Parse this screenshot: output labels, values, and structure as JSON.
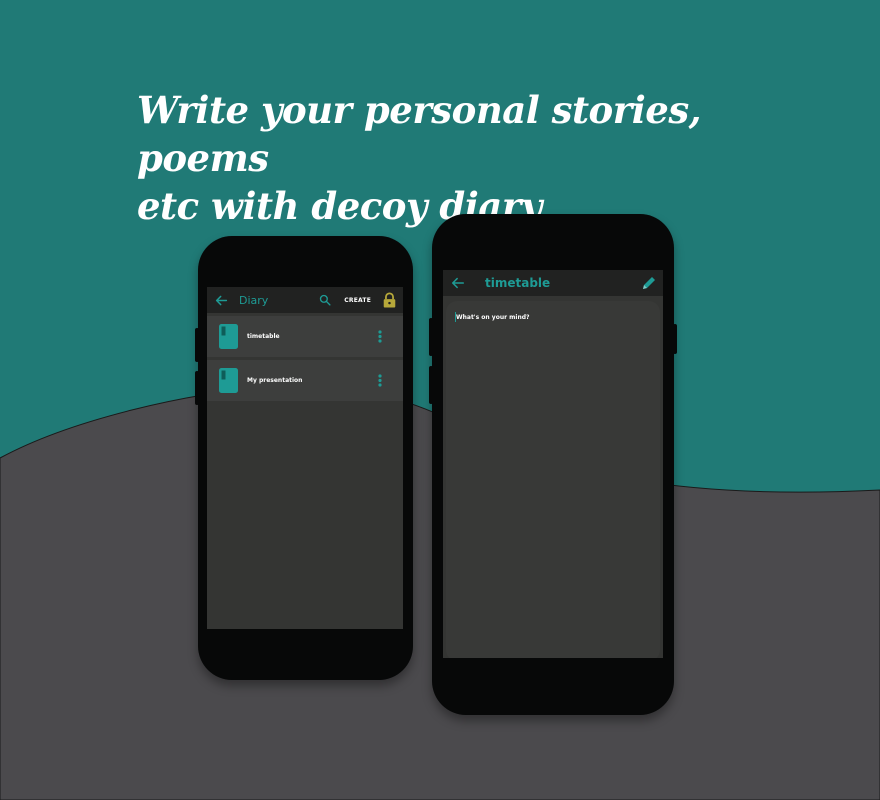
{
  "headline": {
    "line1": "Write your personal stories, poems",
    "line2": "etc with decoy diary"
  },
  "colors": {
    "teal_bg": "#207a76",
    "grey_wave": "#4b4a4d",
    "accent": "#1e9b95",
    "lock": "#b6a83a"
  },
  "phone_list": {
    "appbar": {
      "back_icon": "arrow-left-icon",
      "title": "Diary",
      "search_icon": "search-icon",
      "create_label": "CREATE",
      "lock_icon": "lock-icon"
    },
    "items": [
      {
        "label": "timetable",
        "icon": "book-icon",
        "menu_icon": "more-vertical-icon"
      },
      {
        "label": "My presentation",
        "icon": "book-icon",
        "menu_icon": "more-vertical-icon"
      }
    ]
  },
  "phone_editor": {
    "appbar": {
      "back_icon": "arrow-left-icon",
      "title": "timetable",
      "edit_icon": "pencil-icon"
    },
    "editor": {
      "placeholder": "What's on your mind?"
    }
  }
}
